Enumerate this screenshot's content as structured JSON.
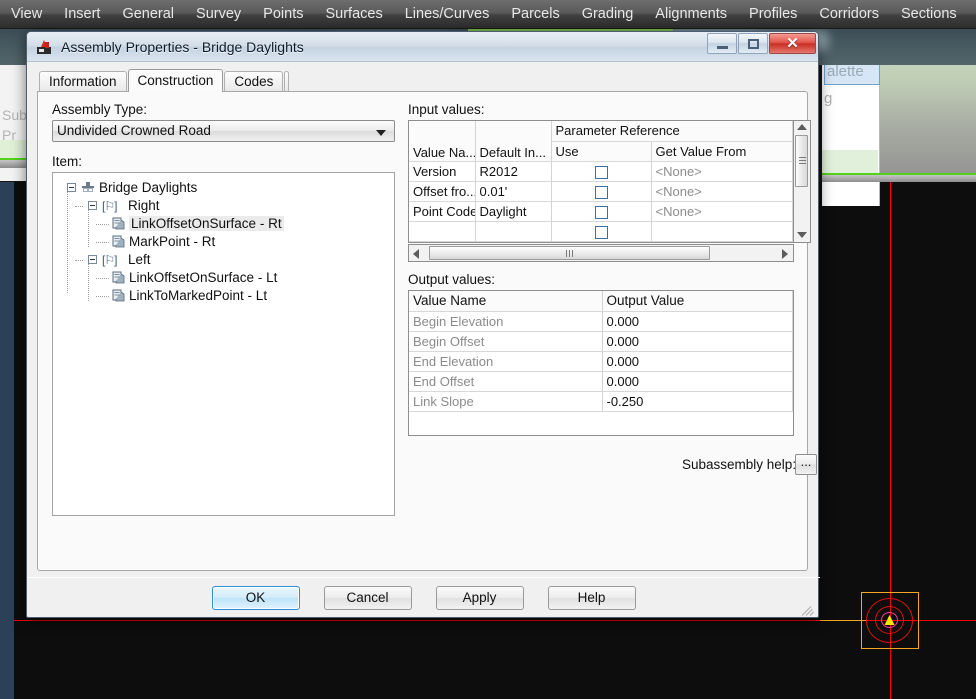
{
  "background": {
    "menubar": {
      "items": [
        "View",
        "Insert",
        "General",
        "Survey",
        "Points",
        "Surfaces",
        "Lines/Curves",
        "Parcels",
        "Grading",
        "Alignments",
        "Profiles",
        "Corridors",
        "Sections"
      ]
    },
    "palette": {
      "tab_label": "alette",
      "sub_label": "g"
    },
    "left_ghost": {
      "line1": "Sub",
      "line2": "Pr"
    },
    "colors": {
      "accent_green": "#52d21a",
      "crosshair_red": "#f20000",
      "pickbox_orange": "#f5a623",
      "canvas_black": "#0d0d0d"
    }
  },
  "dialog": {
    "title": "Assembly Properties - Bridge Daylights",
    "window_buttons": {
      "minimize": "minimize-label",
      "maximize": "maximize-label",
      "close": "✕"
    },
    "tabs": [
      {
        "label": "Information",
        "active": false
      },
      {
        "label": "Construction",
        "active": true
      },
      {
        "label": "Codes",
        "active": false
      }
    ],
    "assembly_type": {
      "label": "Assembly Type:",
      "value": "Undivided Crowned Road"
    },
    "item": {
      "label": "Item:",
      "tree": [
        {
          "text": "Bridge Daylights",
          "level": 0,
          "icon": "assembly-icon",
          "selected": false
        },
        {
          "text": "Right",
          "level": 1,
          "icon": "group-icon",
          "selected": false
        },
        {
          "text": "LinkOffsetOnSurface - Rt",
          "level": 2,
          "icon": "subassembly-icon",
          "selected": true
        },
        {
          "text": "MarkPoint - Rt",
          "level": 2,
          "icon": "subassembly-icon",
          "selected": false
        },
        {
          "text": "Left",
          "level": 1,
          "icon": "group-icon",
          "selected": false
        },
        {
          "text": "LinkOffsetOnSurface - Lt",
          "level": 2,
          "icon": "subassembly-icon",
          "selected": false
        },
        {
          "text": "LinkToMarkedPoint - Lt",
          "level": 2,
          "icon": "subassembly-icon",
          "selected": false
        }
      ]
    },
    "input_values": {
      "label": "Input values:",
      "group_header": "Parameter Reference",
      "headers": [
        "Value Na...",
        "Default In...",
        "Use",
        "Get Value From"
      ],
      "rows": [
        {
          "value_name": "Version",
          "default_input": "R2012",
          "use": false,
          "get_value_from": "<None>"
        },
        {
          "value_name": "Offset fro...",
          "default_input": "0.01'",
          "use": false,
          "get_value_from": "<None>"
        },
        {
          "value_name": "Point Codes",
          "default_input": "Daylight",
          "use": false,
          "get_value_from": "<None>"
        }
      ]
    },
    "output_values": {
      "label": "Output values:",
      "headers": [
        "Value Name",
        "Output Value"
      ],
      "rows": [
        {
          "value_name": "Begin Elevation",
          "output_value": "0.000"
        },
        {
          "value_name": "Begin Offset",
          "output_value": "0.000"
        },
        {
          "value_name": "End Elevation",
          "output_value": "0.000"
        },
        {
          "value_name": "End Offset",
          "output_value": "0.000"
        },
        {
          "value_name": "Link Slope",
          "output_value": "-0.250"
        }
      ]
    },
    "subassembly_help": {
      "label": "Subassembly help:",
      "button_label": "..."
    },
    "buttons": [
      {
        "label": "OK",
        "default": true
      },
      {
        "label": "Cancel",
        "default": false
      },
      {
        "label": "Apply",
        "default": false
      },
      {
        "label": "Help",
        "default": false
      }
    ]
  }
}
